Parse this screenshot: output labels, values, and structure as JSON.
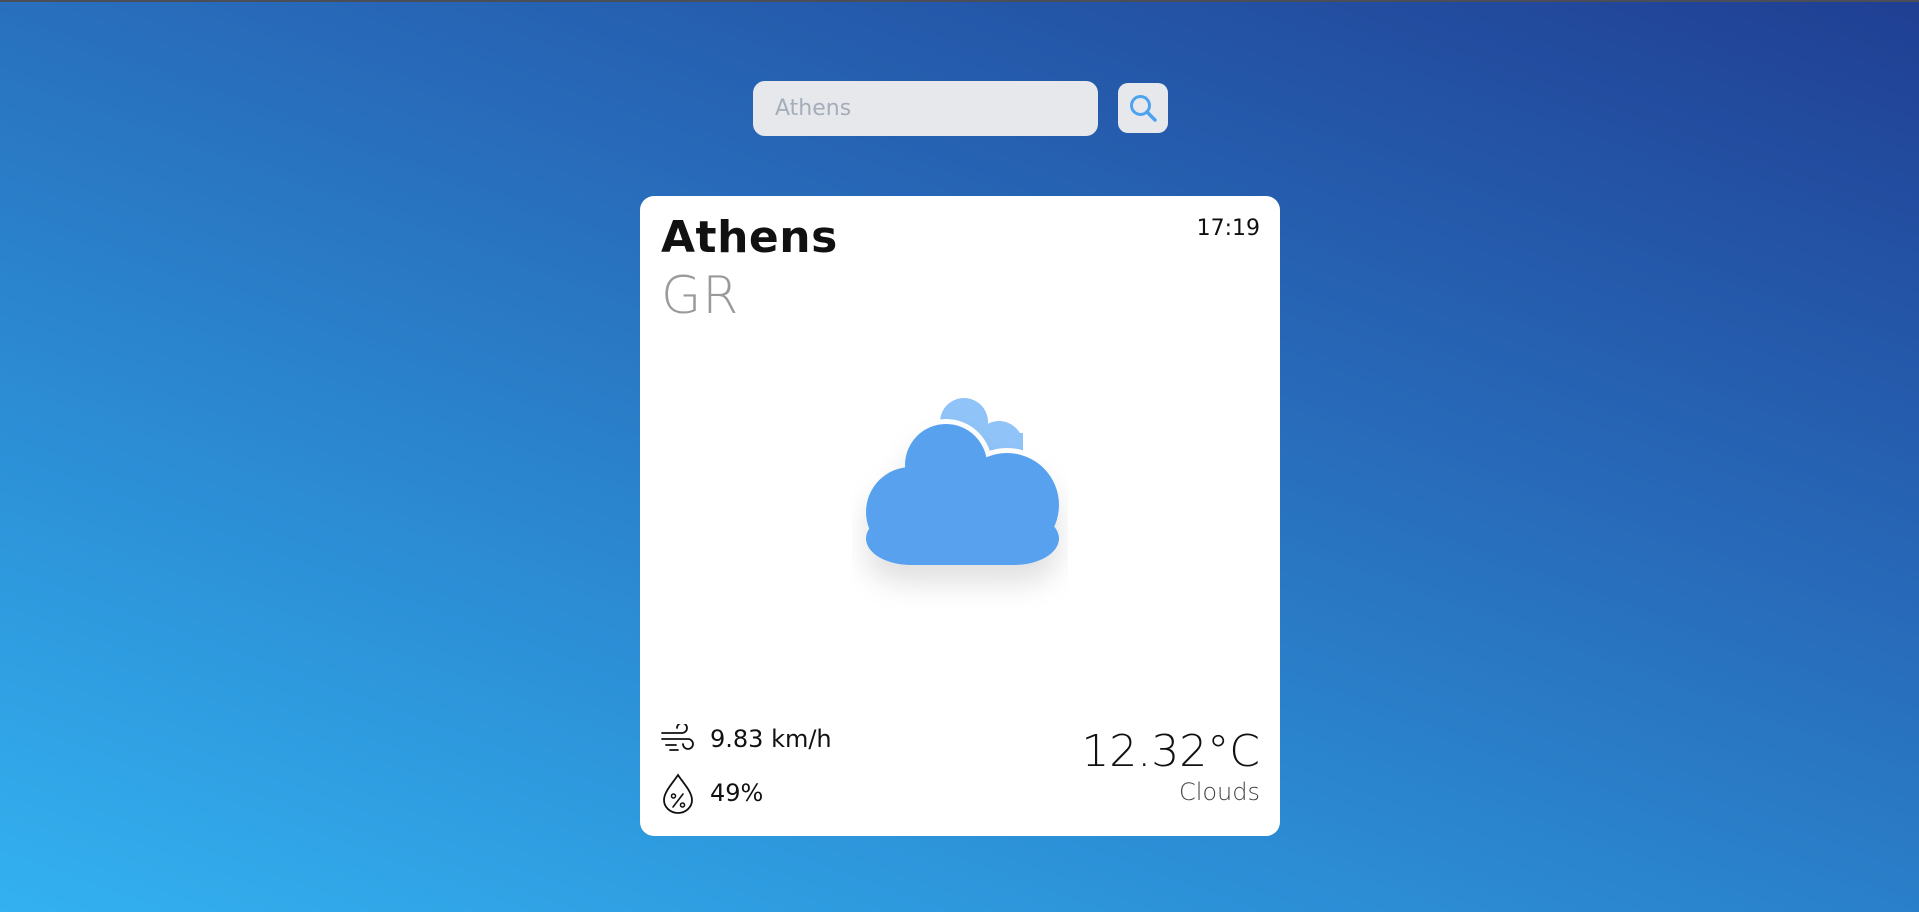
{
  "search": {
    "placeholder": "Athens",
    "value": ""
  },
  "card": {
    "city": "Athens",
    "country": "GR",
    "time": "17:19",
    "wind": "9.83 km/h",
    "humidity": "49%",
    "temperature": "12.32°C",
    "condition": "Clouds"
  },
  "icons": {
    "search": "search-icon",
    "weather": "clouds-icon",
    "wind": "wind-icon",
    "humidity": "humidity-drop-icon"
  },
  "colors": {
    "accent": "#4ea3f0",
    "cloud_main": "#59a1ef",
    "cloud_back": "#90c3f7",
    "card_bg": "#ffffff",
    "input_bg": "#e6e8ec"
  }
}
